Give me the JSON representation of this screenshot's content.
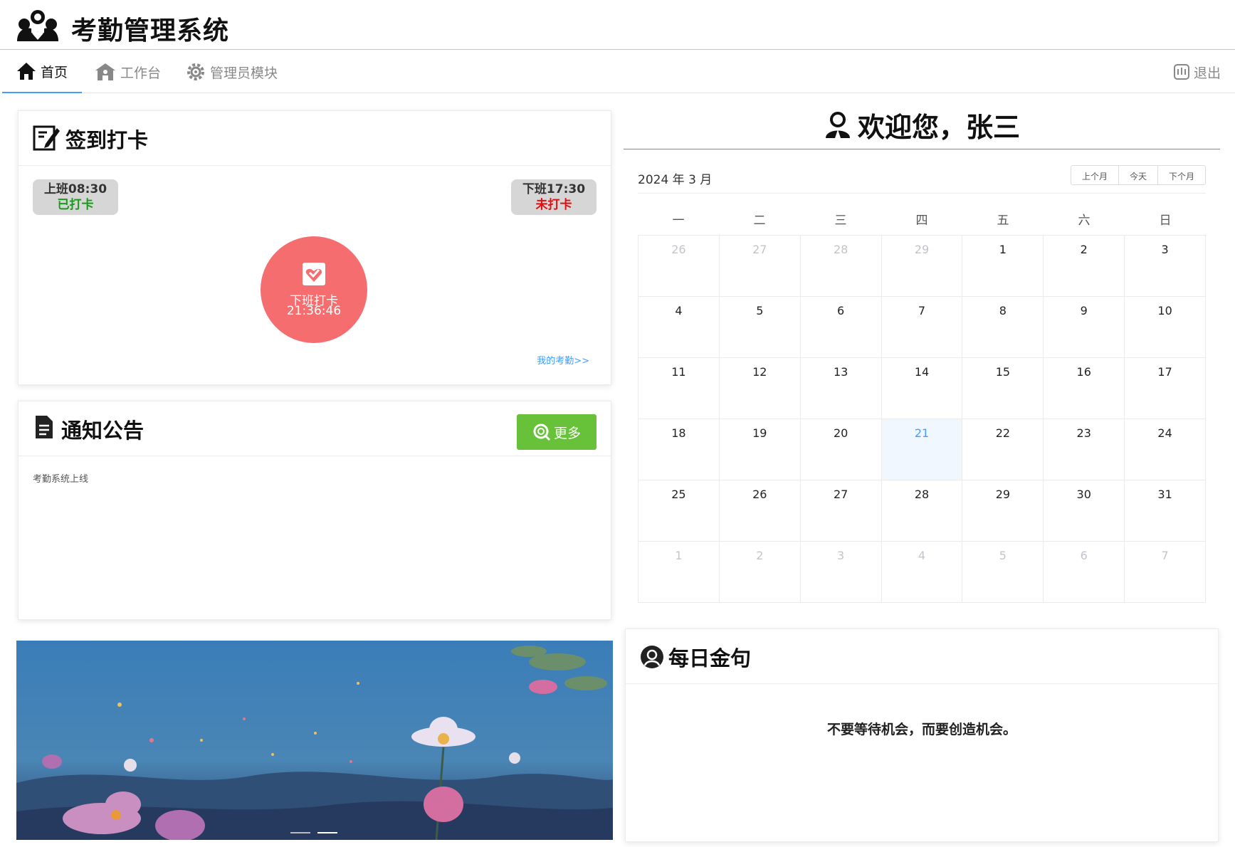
{
  "app": {
    "title": "考勤管理系统"
  },
  "nav": {
    "tabs": [
      {
        "label": "首页"
      },
      {
        "label": "工作台"
      },
      {
        "label": "管理员模块"
      }
    ],
    "logout": "退出"
  },
  "checkin": {
    "title": "签到打卡",
    "morning": {
      "label": "上班08:30",
      "status": "已打卡"
    },
    "evening": {
      "label": "下班17:30",
      "status": "未打卡"
    },
    "button": {
      "label": "下班打卡",
      "time": "21:36:46"
    },
    "my_attendance_link": "我的考勤>>"
  },
  "notice": {
    "title": "通知公告",
    "more": "更多",
    "items": [
      "考勤系统上线"
    ]
  },
  "welcome": {
    "text": "欢迎您，张三"
  },
  "calendar": {
    "month_label": "2024 年 3 月",
    "buttons": {
      "prev": "上个月",
      "today": "今天",
      "next": "下个月"
    },
    "weekdays": [
      "一",
      "二",
      "三",
      "四",
      "五",
      "六",
      "日"
    ],
    "weeks": [
      [
        "26",
        "27",
        "28",
        "29",
        "1",
        "2",
        "3"
      ],
      [
        "4",
        "5",
        "6",
        "7",
        "8",
        "9",
        "10"
      ],
      [
        "11",
        "12",
        "13",
        "14",
        "15",
        "16",
        "17"
      ],
      [
        "18",
        "19",
        "20",
        "21",
        "22",
        "23",
        "24"
      ],
      [
        "25",
        "26",
        "27",
        "28",
        "29",
        "30",
        "31"
      ],
      [
        "1",
        "2",
        "3",
        "4",
        "5",
        "6",
        "7"
      ]
    ],
    "today": "21"
  },
  "quote": {
    "title": "每日金句",
    "text": "不要等待机会，而要创造机会。"
  },
  "colors": {
    "accent": "#409eff",
    "punch": "#f56d6f",
    "more_btn": "#67c23a",
    "done": "#1a9a1a",
    "not_done": "#e01010"
  }
}
